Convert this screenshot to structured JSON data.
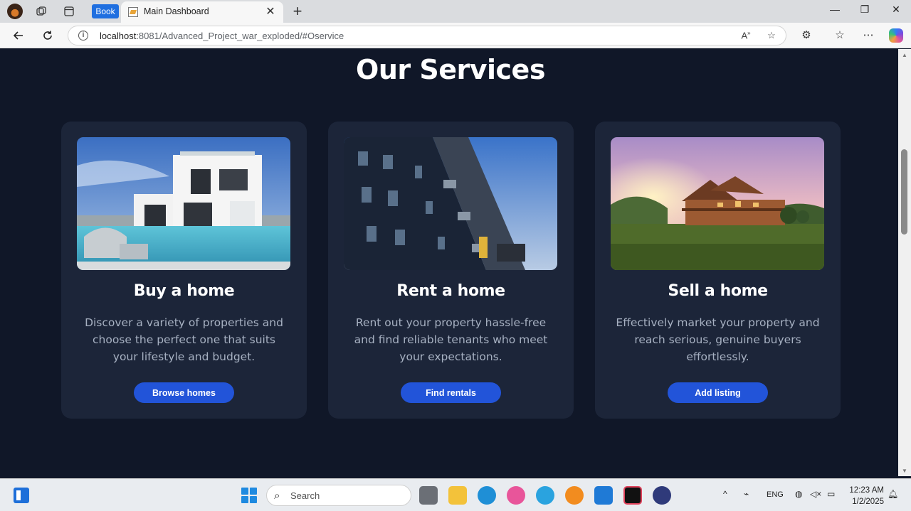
{
  "browser": {
    "profile_icon": "profile-avatar",
    "book_tab_label": "Book",
    "active_tab_title": "Main Dashboard",
    "tab_close": "✕",
    "new_tab": "+",
    "url_host": "localhost",
    "url_rest": ":8081/Advanced_Project_war_exploded/#Oservice",
    "window_controls": {
      "minimize": "—",
      "maximize": "❐",
      "close": "✕"
    }
  },
  "page": {
    "section_title": "Our Services",
    "cards": [
      {
        "image": "modern-white-villa-with-pool",
        "title": "Buy a home",
        "description": "Discover a variety of properties and choose the perfect one that suits your lifestyle and budget.",
        "button": "Browse homes"
      },
      {
        "image": "apartment-building-facade",
        "title": "Rent a home",
        "description": "Rent out your property hassle-free and find reliable tenants who meet your expectations.",
        "button": "Find rentals"
      },
      {
        "image": "wooden-house-at-sunset",
        "title": "Sell a home",
        "description": "Effectively market your property and reach serious, genuine buyers effortlessly.",
        "button": "Add listing"
      }
    ]
  },
  "taskbar": {
    "search_placeholder": "Search",
    "language": "ENG",
    "time": "12:23 AM",
    "date": "1/2/2025"
  },
  "colors": {
    "page_background": "#101728",
    "card_background": "#1c2539",
    "button": "#2254d9",
    "description_text": "#a7b1c2"
  }
}
